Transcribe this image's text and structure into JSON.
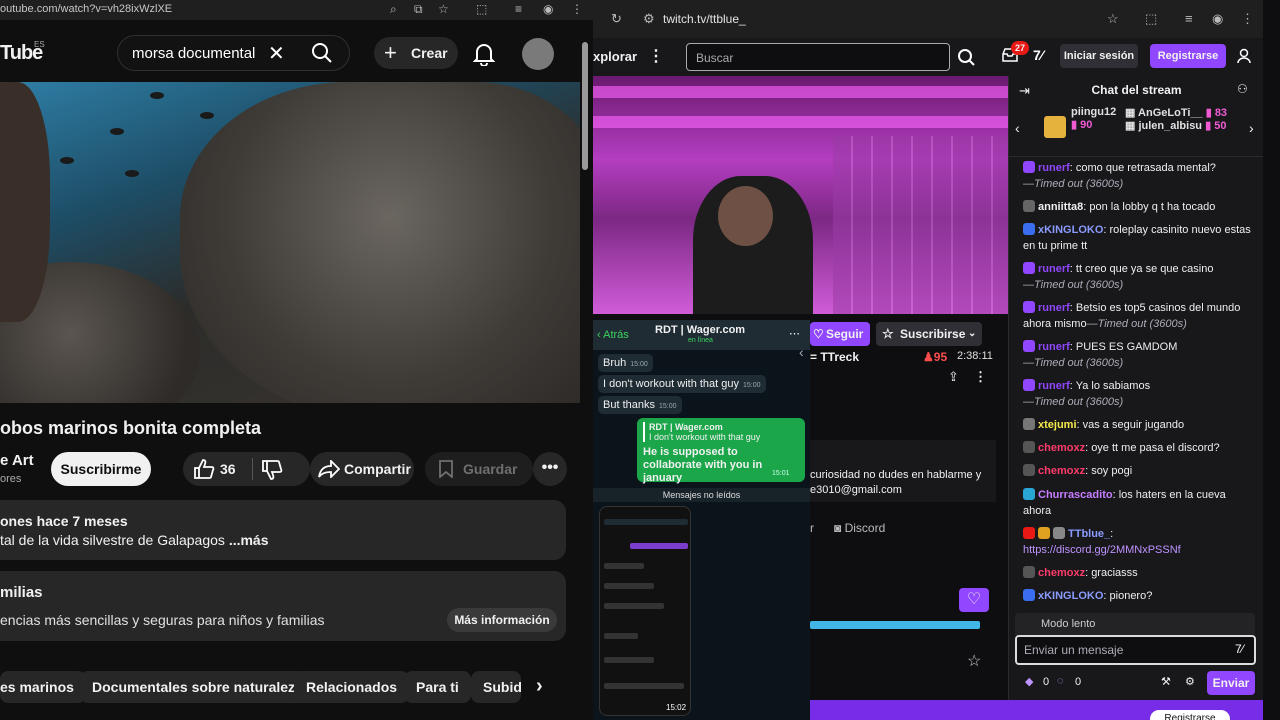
{
  "youtube": {
    "url": "outube.com/watch?v=vh28ixWzlXE",
    "logo": "Tube",
    "region": "ES",
    "search_query": "morsa documental",
    "create_label": "Crear",
    "video_title": "obos marinos bonita completa",
    "channel_name": "e Art",
    "subs_text": "ores",
    "subscribe_label": "Suscribirme",
    "like_count": "36",
    "share_label": "Compartir",
    "save_label": "Guardar",
    "desc_line1": "ones  hace 7 meses",
    "desc_line2": "tal de la vida silvestre de Galapagos ",
    "desc_more": "...más",
    "info_title": "milias",
    "info_sub": "encias más sencillas y seguras para niños y familias",
    "info_button": "Más información",
    "chips": [
      "es marinos",
      "Documentales sobre naturaleza",
      "Relacionados",
      "Para ti",
      "Subid"
    ]
  },
  "twitch": {
    "url": "twitch.tv/ttblue_",
    "explore": "xplorar",
    "search_placeholder": "Buscar",
    "notif_count": "27",
    "login_label": "Iniciar sesión",
    "register_label": "Registrarse",
    "follow_label": "Seguir",
    "subscribe_label": "Suscribirse",
    "game": "= TTreck",
    "viewers": "95",
    "uptime": "2:38:11",
    "panel_text1": "curiosidad no dudes en hablarme y",
    "panel_text2": "e3010@gmail.com",
    "links_left": "r",
    "links_discord": "Discord",
    "bottom_button": "Registrarse"
  },
  "whatsapp": {
    "back_label": "Atrás",
    "contact": "RDT | Wager.com",
    "status": "en línea",
    "msg1": "Bruh",
    "msg1_time": "15:00",
    "msg2": "I don't workout with that guy",
    "msg2_time": "15:00",
    "msg3": "But thanks",
    "msg3_time": "15:00",
    "quote_author": "RDT | Wager.com",
    "quote_text": "I don't workout with that guy",
    "reply": "He is supposed to collaborate with you in january",
    "reply_time": "15:01",
    "unread": "Mensajes no leídos",
    "phone_time": "15:02"
  },
  "chat": {
    "title": "Chat del stream",
    "gifts": [
      {
        "name": "piingu12",
        "value": "90"
      },
      {
        "name": "AnGeLoTi__",
        "value": "83"
      },
      {
        "name": "julen_albisu",
        "value": "50"
      }
    ],
    "messages": [
      {
        "user": "runerf",
        "color": "#9146ff",
        "text": ": como que retrasada mental?",
        "timeout": "—Timed out (3600s)"
      },
      {
        "user": "anniitta8",
        "color": "#efeff1",
        "text": ": pon la lobby q t ha tocado",
        "timeout": ""
      },
      {
        "user": "xKINGLOKO",
        "color": "#8a9bff",
        "text": ": roleplay casinito nuevo estas en tu prime tt",
        "timeout": ""
      },
      {
        "user": "runerf",
        "color": "#9146ff",
        "text": ": tt creo que ya se que casino",
        "timeout": "—Timed out (3600s)"
      },
      {
        "user": "runerf",
        "color": "#9146ff",
        "text": ": Betsio es top5 casinos del mundo ahora mismo",
        "timeout": "—Timed out (3600s)"
      },
      {
        "user": "runerf",
        "color": "#9146ff",
        "text": ": PUES ES GAMDOM",
        "timeout": "—Timed out (3600s)"
      },
      {
        "user": "runerf",
        "color": "#9146ff",
        "text": ": Ya lo sabiamos",
        "timeout": "—Timed out (3600s)"
      },
      {
        "user": "xtejumi",
        "color": "#f6e84a",
        "text": ": vas a seguir jugando",
        "timeout": ""
      },
      {
        "user": "chemoxz",
        "color": "#ff3b6b",
        "text": ": oye tt me pasa el discord?",
        "timeout": ""
      },
      {
        "user": "chemoxz",
        "color": "#ff3b6b",
        "text": ": soy pogi",
        "timeout": ""
      },
      {
        "user": "Churrascadito",
        "color": "#c77dff",
        "text": ": los haters en la cueva ahora",
        "timeout": ""
      },
      {
        "user": "TTblue_",
        "color": "#8a9bff",
        "text": ":",
        "timeout": ""
      },
      {
        "user": "",
        "color": "#bf94ff",
        "text": "https://discord.gg/2MMNxPSSNf",
        "timeout": ""
      },
      {
        "user": "chemoxz",
        "color": "#ff3b6b",
        "text": ": graciasss",
        "timeout": ""
      },
      {
        "user": "xKINGLOKO",
        "color": "#8a9bff",
        "text": ": pionero?",
        "timeout": ""
      }
    ],
    "slow_mode": "Modo lento",
    "input_placeholder": "Enviar un mensaje",
    "points1": "0",
    "points2": "0",
    "send_label": "Enviar"
  }
}
